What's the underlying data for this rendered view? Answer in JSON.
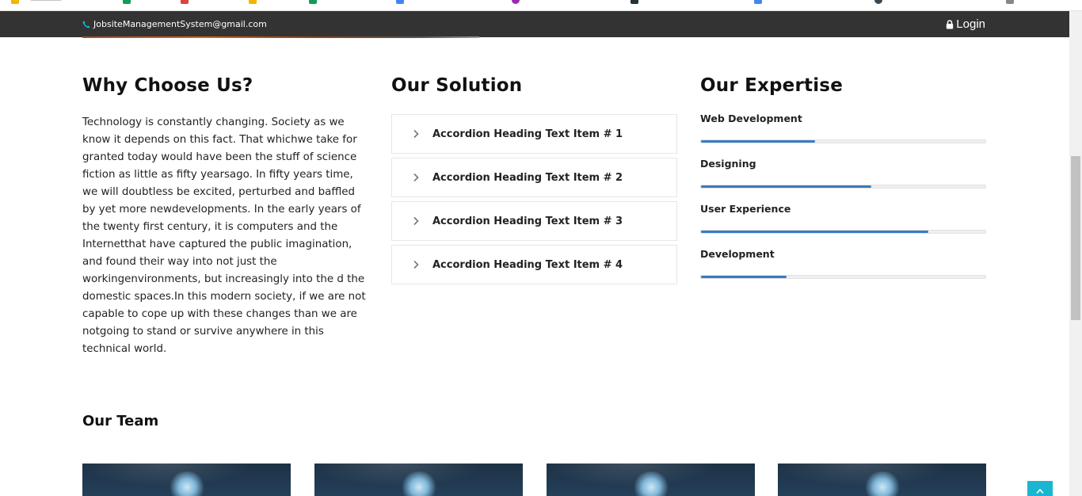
{
  "header": {
    "email": "JobsiteManagementSystem@gmail.com",
    "login_label": "Login",
    "icons": [
      "phone-icon",
      "lock-icon"
    ]
  },
  "why": {
    "title": "Why Choose Us?",
    "body": "Technology is constantly changing. Society as we know it depends on this fact. That whichwe take for granted today would have been the stuff of science fiction as little as fifty yearsago. In fifty years time, we will doubtless be excited, perturbed and baffled by yet more newdevelopments. In the early years of the twenty first century, it is computers and the Internetthat have captured the public imagination, and found their way into not just the workingenvironments, but increasingly into the d the domestic spaces.In this modern society, if we are not capable to cope up with these changes than we are notgoing to stand or survive anywhere in this technical world."
  },
  "solution": {
    "title": "Our Solution",
    "items": [
      {
        "label": "Accordion Heading Text Item # 1"
      },
      {
        "label": "Accordion Heading Text Item # 2"
      },
      {
        "label": "Accordion Heading Text Item # 3"
      },
      {
        "label": "Accordion Heading Text Item # 4"
      }
    ]
  },
  "expertise": {
    "title": "Our Expertise",
    "skills": [
      {
        "label": "Web Development",
        "percent": 40
      },
      {
        "label": "Designing",
        "percent": 60
      },
      {
        "label": "User Experience",
        "percent": 80
      },
      {
        "label": "Development",
        "percent": 30
      }
    ]
  },
  "team": {
    "title": "Our Team"
  },
  "colors": {
    "topbar": "#333333",
    "accent": "#19b5d1",
    "progress": "#3a7bc0"
  }
}
